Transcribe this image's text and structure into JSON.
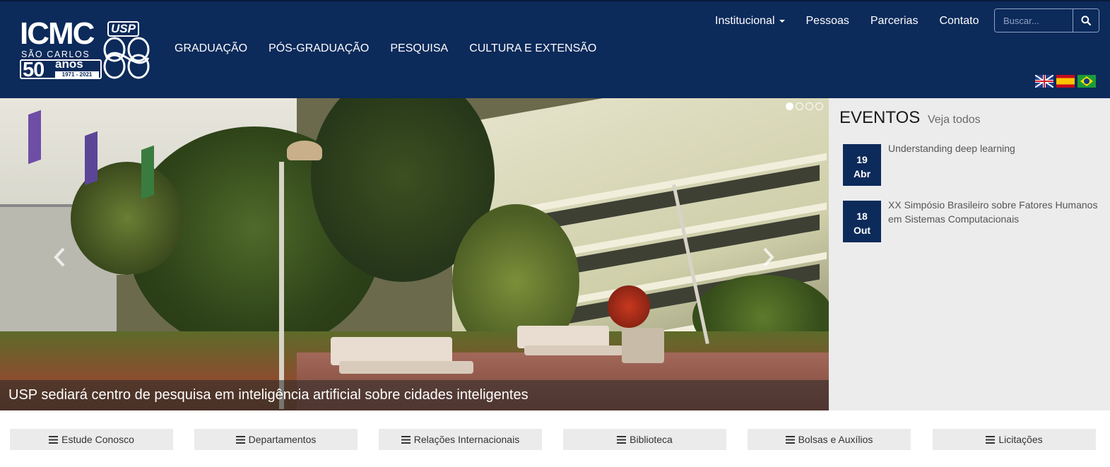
{
  "header": {
    "logo": {
      "wordmark": "ICMC",
      "usp": "USP",
      "campus": "SÃO CARLOS",
      "anniversary_number": "50",
      "anniversary_word": "anos",
      "anniversary_years": "1971 - 2021"
    },
    "main_nav": [
      {
        "label": "GRADUAÇÃO"
      },
      {
        "label": "PÓS-GRADUAÇÃO"
      },
      {
        "label": "PESQUISA"
      },
      {
        "label": "CULTURA E EXTENSÃO"
      }
    ],
    "top_nav": [
      {
        "label": "Institucional"
      },
      {
        "label": "Pessoas"
      },
      {
        "label": "Parcerias"
      },
      {
        "label": "Contato"
      }
    ],
    "search": {
      "placeholder": "Buscar..."
    },
    "languages": [
      "english-flag",
      "spanish-flag",
      "brazil-flag"
    ]
  },
  "hero": {
    "caption": "USP sediará centro de pesquisa em inteligência artificial sobre cidades inteligentes",
    "slides": 4,
    "active_slide": 1
  },
  "events": {
    "title": "EVENTOS",
    "see_all": "Veja todos",
    "items": [
      {
        "day": "19",
        "month": "Abr",
        "title": "Understanding deep learning"
      },
      {
        "day": "18",
        "month": "Out",
        "title": "XX Simpósio Brasileiro sobre Fatores Humanos em Sistemas Computacionais"
      }
    ]
  },
  "quick_links": [
    {
      "label": "Estude Conosco"
    },
    {
      "label": "Departamentos"
    },
    {
      "label": "Relações Internacionais"
    },
    {
      "label": "Biblioteca"
    },
    {
      "label": "Bolsas e Auxílios"
    },
    {
      "label": "Licitações"
    }
  ],
  "colors": {
    "brand_navy": "#0c2a5a",
    "event_panel": "#ececec",
    "quick_link_bg": "#ebebeb"
  }
}
